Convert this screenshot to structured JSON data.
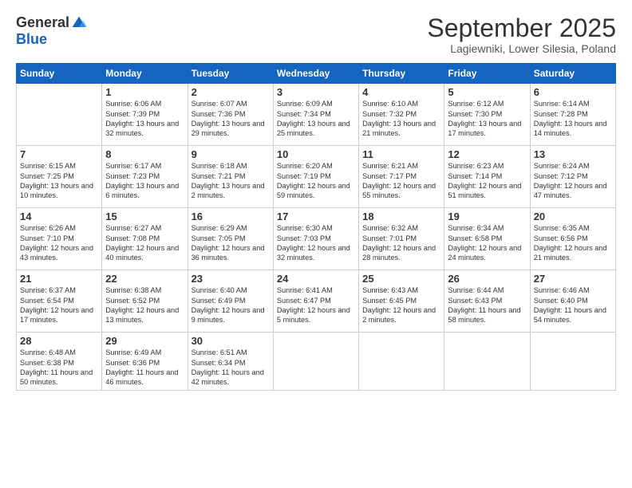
{
  "logo": {
    "general": "General",
    "blue": "Blue"
  },
  "title": "September 2025",
  "location": "Lagiewniki, Lower Silesia, Poland",
  "weekdays": [
    "Sunday",
    "Monday",
    "Tuesday",
    "Wednesday",
    "Thursday",
    "Friday",
    "Saturday"
  ],
  "weeks": [
    [
      {
        "day": "",
        "sunrise": "",
        "sunset": "",
        "daylight": ""
      },
      {
        "day": "1",
        "sunrise": "Sunrise: 6:06 AM",
        "sunset": "Sunset: 7:39 PM",
        "daylight": "Daylight: 13 hours and 32 minutes."
      },
      {
        "day": "2",
        "sunrise": "Sunrise: 6:07 AM",
        "sunset": "Sunset: 7:36 PM",
        "daylight": "Daylight: 13 hours and 29 minutes."
      },
      {
        "day": "3",
        "sunrise": "Sunrise: 6:09 AM",
        "sunset": "Sunset: 7:34 PM",
        "daylight": "Daylight: 13 hours and 25 minutes."
      },
      {
        "day": "4",
        "sunrise": "Sunrise: 6:10 AM",
        "sunset": "Sunset: 7:32 PM",
        "daylight": "Daylight: 13 hours and 21 minutes."
      },
      {
        "day": "5",
        "sunrise": "Sunrise: 6:12 AM",
        "sunset": "Sunset: 7:30 PM",
        "daylight": "Daylight: 13 hours and 17 minutes."
      },
      {
        "day": "6",
        "sunrise": "Sunrise: 6:14 AM",
        "sunset": "Sunset: 7:28 PM",
        "daylight": "Daylight: 13 hours and 14 minutes."
      }
    ],
    [
      {
        "day": "7",
        "sunrise": "Sunrise: 6:15 AM",
        "sunset": "Sunset: 7:25 PM",
        "daylight": "Daylight: 13 hours and 10 minutes."
      },
      {
        "day": "8",
        "sunrise": "Sunrise: 6:17 AM",
        "sunset": "Sunset: 7:23 PM",
        "daylight": "Daylight: 13 hours and 6 minutes."
      },
      {
        "day": "9",
        "sunrise": "Sunrise: 6:18 AM",
        "sunset": "Sunset: 7:21 PM",
        "daylight": "Daylight: 13 hours and 2 minutes."
      },
      {
        "day": "10",
        "sunrise": "Sunrise: 6:20 AM",
        "sunset": "Sunset: 7:19 PM",
        "daylight": "Daylight: 12 hours and 59 minutes."
      },
      {
        "day": "11",
        "sunrise": "Sunrise: 6:21 AM",
        "sunset": "Sunset: 7:17 PM",
        "daylight": "Daylight: 12 hours and 55 minutes."
      },
      {
        "day": "12",
        "sunrise": "Sunrise: 6:23 AM",
        "sunset": "Sunset: 7:14 PM",
        "daylight": "Daylight: 12 hours and 51 minutes."
      },
      {
        "day": "13",
        "sunrise": "Sunrise: 6:24 AM",
        "sunset": "Sunset: 7:12 PM",
        "daylight": "Daylight: 12 hours and 47 minutes."
      }
    ],
    [
      {
        "day": "14",
        "sunrise": "Sunrise: 6:26 AM",
        "sunset": "Sunset: 7:10 PM",
        "daylight": "Daylight: 12 hours and 43 minutes."
      },
      {
        "day": "15",
        "sunrise": "Sunrise: 6:27 AM",
        "sunset": "Sunset: 7:08 PM",
        "daylight": "Daylight: 12 hours and 40 minutes."
      },
      {
        "day": "16",
        "sunrise": "Sunrise: 6:29 AM",
        "sunset": "Sunset: 7:05 PM",
        "daylight": "Daylight: 12 hours and 36 minutes."
      },
      {
        "day": "17",
        "sunrise": "Sunrise: 6:30 AM",
        "sunset": "Sunset: 7:03 PM",
        "daylight": "Daylight: 12 hours and 32 minutes."
      },
      {
        "day": "18",
        "sunrise": "Sunrise: 6:32 AM",
        "sunset": "Sunset: 7:01 PM",
        "daylight": "Daylight: 12 hours and 28 minutes."
      },
      {
        "day": "19",
        "sunrise": "Sunrise: 6:34 AM",
        "sunset": "Sunset: 6:58 PM",
        "daylight": "Daylight: 12 hours and 24 minutes."
      },
      {
        "day": "20",
        "sunrise": "Sunrise: 6:35 AM",
        "sunset": "Sunset: 6:56 PM",
        "daylight": "Daylight: 12 hours and 21 minutes."
      }
    ],
    [
      {
        "day": "21",
        "sunrise": "Sunrise: 6:37 AM",
        "sunset": "Sunset: 6:54 PM",
        "daylight": "Daylight: 12 hours and 17 minutes."
      },
      {
        "day": "22",
        "sunrise": "Sunrise: 6:38 AM",
        "sunset": "Sunset: 6:52 PM",
        "daylight": "Daylight: 12 hours and 13 minutes."
      },
      {
        "day": "23",
        "sunrise": "Sunrise: 6:40 AM",
        "sunset": "Sunset: 6:49 PM",
        "daylight": "Daylight: 12 hours and 9 minutes."
      },
      {
        "day": "24",
        "sunrise": "Sunrise: 6:41 AM",
        "sunset": "Sunset: 6:47 PM",
        "daylight": "Daylight: 12 hours and 5 minutes."
      },
      {
        "day": "25",
        "sunrise": "Sunrise: 6:43 AM",
        "sunset": "Sunset: 6:45 PM",
        "daylight": "Daylight: 12 hours and 2 minutes."
      },
      {
        "day": "26",
        "sunrise": "Sunrise: 6:44 AM",
        "sunset": "Sunset: 6:43 PM",
        "daylight": "Daylight: 11 hours and 58 minutes."
      },
      {
        "day": "27",
        "sunrise": "Sunrise: 6:46 AM",
        "sunset": "Sunset: 6:40 PM",
        "daylight": "Daylight: 11 hours and 54 minutes."
      }
    ],
    [
      {
        "day": "28",
        "sunrise": "Sunrise: 6:48 AM",
        "sunset": "Sunset: 6:38 PM",
        "daylight": "Daylight: 11 hours and 50 minutes."
      },
      {
        "day": "29",
        "sunrise": "Sunrise: 6:49 AM",
        "sunset": "Sunset: 6:36 PM",
        "daylight": "Daylight: 11 hours and 46 minutes."
      },
      {
        "day": "30",
        "sunrise": "Sunrise: 6:51 AM",
        "sunset": "Sunset: 6:34 PM",
        "daylight": "Daylight: 11 hours and 42 minutes."
      },
      {
        "day": "",
        "sunrise": "",
        "sunset": "",
        "daylight": ""
      },
      {
        "day": "",
        "sunrise": "",
        "sunset": "",
        "daylight": ""
      },
      {
        "day": "",
        "sunrise": "",
        "sunset": "",
        "daylight": ""
      },
      {
        "day": "",
        "sunrise": "",
        "sunset": "",
        "daylight": ""
      }
    ]
  ]
}
